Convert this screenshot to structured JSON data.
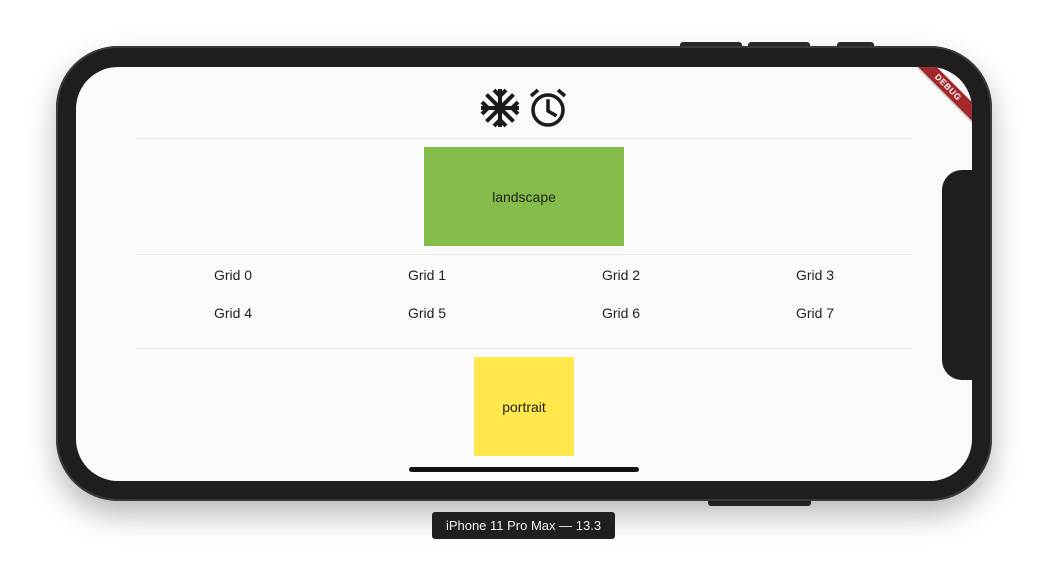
{
  "app": {
    "debug_banner": "DEBUG",
    "device_label": "iPhone 11 Pro Max — 13.3"
  },
  "header": {
    "icons": [
      "snowflake-icon",
      "alarm-clock-icon"
    ]
  },
  "orientation_boxes": {
    "landscape": {
      "label": "landscape",
      "color": "#84bd4a"
    },
    "portrait": {
      "label": "portrait",
      "color": "#ffe74c"
    }
  },
  "grid": {
    "items": [
      "Grid 0",
      "Grid 1",
      "Grid 2",
      "Grid 3",
      "Grid 4",
      "Grid 5",
      "Grid 6",
      "Grid 7"
    ]
  }
}
